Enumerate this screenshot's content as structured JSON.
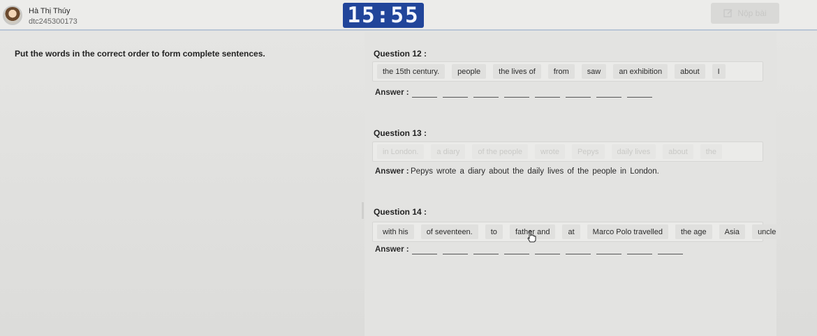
{
  "header": {
    "user_name": "Hà Thị Thúy",
    "user_id": "dtc245300173",
    "timer": "15:55",
    "submit_label": "Nộp bài"
  },
  "instruction": "Put the words in the correct order to form complete sentences.",
  "questions": [
    {
      "title": "Question 12 :",
      "words": [
        "the 15th century.",
        "people",
        "the lives of",
        "from",
        "saw",
        "an exhibition",
        "about",
        "I"
      ],
      "answer_label": "Answer :",
      "answer_text": ""
    },
    {
      "title": "Question 13 :",
      "words": [
        "in London.",
        "a diary",
        "of the people",
        "wrote",
        "Pepys",
        "daily lives",
        "about",
        "the"
      ],
      "answer_label": "Answer :",
      "answer_text": "Pepys wrote a diary about the daily lives of the people in London."
    },
    {
      "title": "Question 14 :",
      "words": [
        "with his",
        "of seventeen.",
        "to",
        "father and",
        "at",
        "Marco Polo travelled",
        "the age",
        "Asia",
        "uncle"
      ],
      "answer_label": "Answer :",
      "answer_text": ""
    }
  ],
  "colors": {
    "timer_bg": "#21459a",
    "background": "#e3e3e1"
  }
}
